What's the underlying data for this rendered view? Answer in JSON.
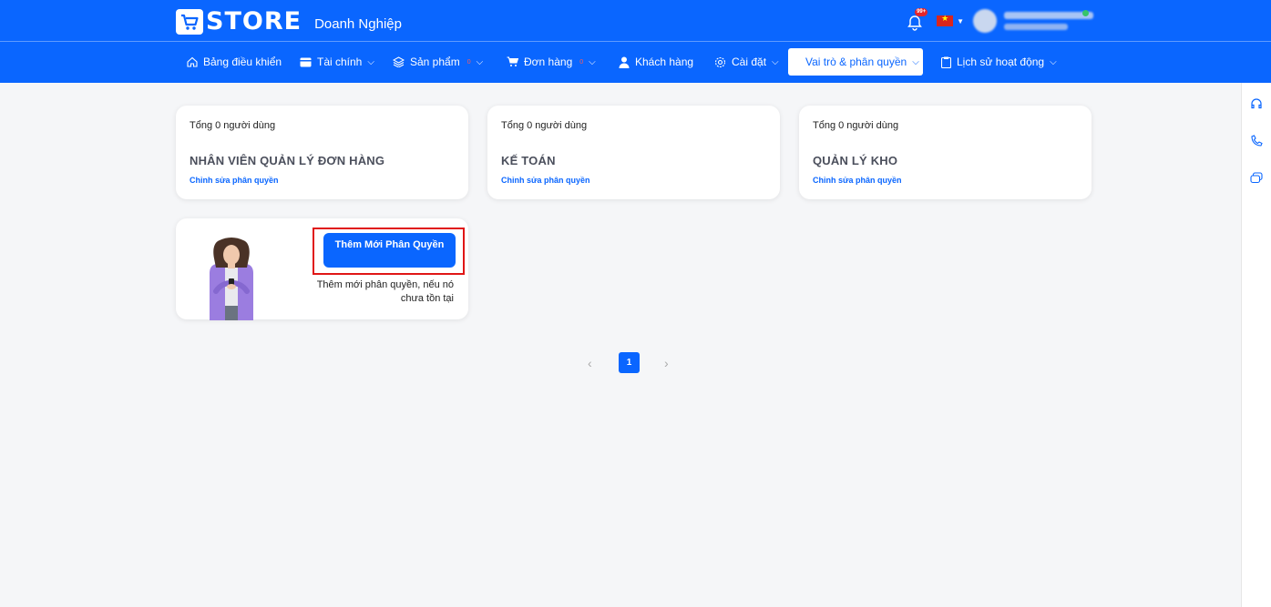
{
  "header": {
    "logo_text": "STORE",
    "subtitle": "Doanh Nghiệp",
    "notification_count": "99+"
  },
  "nav": {
    "items": [
      {
        "label": "Bảng điều khiển",
        "icon": "home-icon"
      },
      {
        "label": "Tài chính",
        "icon": "wallet-icon"
      },
      {
        "label": "Sản phẩm",
        "icon": "layers-icon",
        "count": "0"
      },
      {
        "label": "Đơn hàng",
        "icon": "cart-icon",
        "count": "0"
      },
      {
        "label": "Khách hàng",
        "icon": "user-icon"
      },
      {
        "label": "Cài đặt",
        "icon": "gear-icon"
      },
      {
        "label": "Vai trò & phân quyền",
        "icon": "role-icon"
      },
      {
        "label": "Lịch sử hoạt động",
        "icon": "clipboard-icon"
      }
    ]
  },
  "roles": [
    {
      "total": "Tổng 0 người dùng",
      "title": "NHÂN VIÊN QUẢN LÝ ĐƠN HÀNG",
      "edit": "Chỉnh sửa phân quyền"
    },
    {
      "total": "Tổng 0 người dùng",
      "title": "KẾ TOÁN",
      "edit": "Chỉnh sửa phân quyền"
    },
    {
      "total": "Tổng 0 người dùng",
      "title": "QUẢN LÝ KHO",
      "edit": "Chỉnh sửa phân quyền"
    }
  ],
  "add_role": {
    "button_label": "Thêm Mới Phân Quyền",
    "description": "Thêm mới phân quyền, nếu nó chưa tồn tại"
  },
  "pagination": {
    "prev": "‹",
    "page": "1",
    "next": "›"
  },
  "colors": {
    "primary": "#0a66ff",
    "highlight": "#e01616"
  }
}
